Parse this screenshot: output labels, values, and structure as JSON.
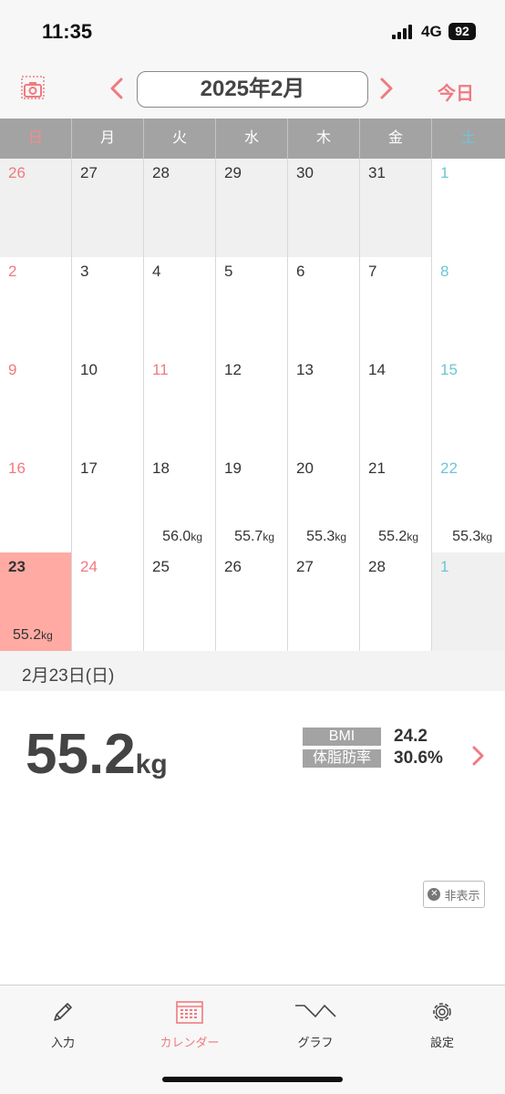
{
  "status": {
    "time": "11:35",
    "network": "4G",
    "battery": "92"
  },
  "header": {
    "month": "2025年2月",
    "today_label": "今日"
  },
  "weekdays": [
    "日",
    "月",
    "火",
    "水",
    "木",
    "金",
    "土"
  ],
  "calendar": [
    [
      {
        "d": "26",
        "type": "other sun"
      },
      {
        "d": "27",
        "type": "other"
      },
      {
        "d": "28",
        "type": "other"
      },
      {
        "d": "29",
        "type": "other"
      },
      {
        "d": "30",
        "type": "other"
      },
      {
        "d": "31",
        "type": "other"
      },
      {
        "d": "1",
        "type": "sat"
      }
    ],
    [
      {
        "d": "2",
        "type": "sun"
      },
      {
        "d": "3",
        "type": ""
      },
      {
        "d": "4",
        "type": ""
      },
      {
        "d": "5",
        "type": ""
      },
      {
        "d": "6",
        "type": ""
      },
      {
        "d": "7",
        "type": ""
      },
      {
        "d": "8",
        "type": "sat"
      }
    ],
    [
      {
        "d": "9",
        "type": "sun"
      },
      {
        "d": "10",
        "type": ""
      },
      {
        "d": "11",
        "type": "hol"
      },
      {
        "d": "12",
        "type": ""
      },
      {
        "d": "13",
        "type": ""
      },
      {
        "d": "14",
        "type": ""
      },
      {
        "d": "15",
        "type": "sat"
      }
    ],
    [
      {
        "d": "16",
        "type": "sun"
      },
      {
        "d": "17",
        "type": ""
      },
      {
        "d": "18",
        "type": "",
        "w": "56.0"
      },
      {
        "d": "19",
        "type": "",
        "w": "55.7"
      },
      {
        "d": "20",
        "type": "",
        "w": "55.3"
      },
      {
        "d": "21",
        "type": "",
        "w": "55.2"
      },
      {
        "d": "22",
        "type": "sat",
        "w": "55.3"
      }
    ],
    [
      {
        "d": "23",
        "type": "selected",
        "w": "55.2"
      },
      {
        "d": "24",
        "type": "hol"
      },
      {
        "d": "25",
        "type": ""
      },
      {
        "d": "26",
        "type": ""
      },
      {
        "d": "27",
        "type": ""
      },
      {
        "d": "28",
        "type": ""
      },
      {
        "d": "1",
        "type": "other sat"
      }
    ]
  ],
  "weight_unit": "kg",
  "selected_date": "2月23日(日)",
  "detail": {
    "weight": "55.2",
    "unit": "kg",
    "bmi_label": "BMI",
    "bmi_value": "24.2",
    "fat_label": "体脂肪率",
    "fat_value": "30.6%",
    "hide_label": "非表示"
  },
  "tabs": [
    {
      "label": "入力",
      "icon": "pencil-icon"
    },
    {
      "label": "カレンダー",
      "icon": "calendar-icon",
      "active": true
    },
    {
      "label": "グラフ",
      "icon": "graph-icon"
    },
    {
      "label": "設定",
      "icon": "gear-icon"
    }
  ],
  "colors": {
    "accent": "#f07a80",
    "saturday": "#6cc6d6",
    "selected": "#ffaaa3",
    "header_gray": "#a3a3a3"
  }
}
